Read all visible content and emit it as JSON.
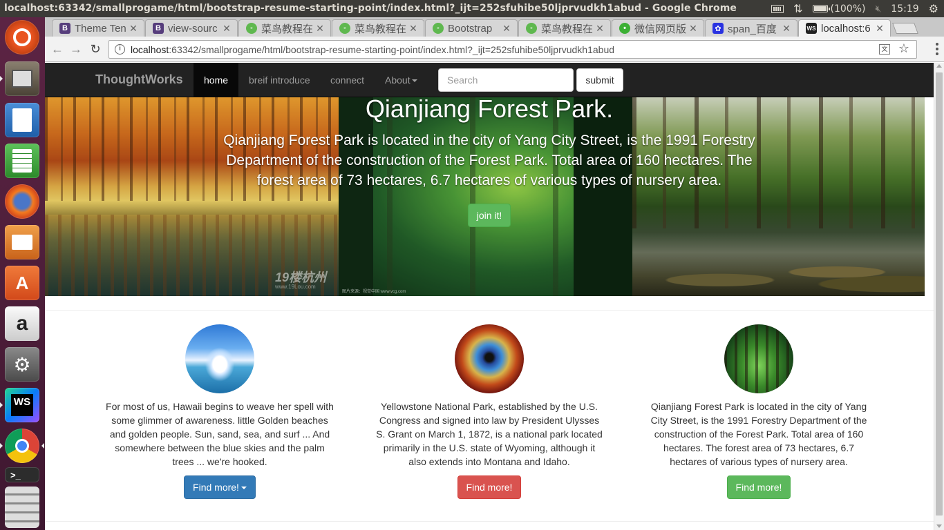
{
  "system": {
    "window_title": "localhost:63342/smallprogame/html/bootstrap-resume-starting-point/index.html?_ijt=252sfuhibe50ljprvudkh1abud - Google Chrome",
    "battery": "(100%)",
    "clock": "15:19"
  },
  "tabs": [
    {
      "label": "Theme Ten",
      "icon": "bootstrap-favicon",
      "color": "#563d7c"
    },
    {
      "label": "view-sourc",
      "icon": "bootstrap-favicon",
      "color": "#563d7c"
    },
    {
      "label": "菜鸟教程在",
      "icon": "runoob-favicon",
      "color": "#5fb84f"
    },
    {
      "label": "菜鸟教程在",
      "icon": "runoob-favicon",
      "color": "#5fb84f"
    },
    {
      "label": "Bootstrap",
      "icon": "runoob-favicon",
      "color": "#5fb84f"
    },
    {
      "label": "菜鸟教程在",
      "icon": "runoob-favicon",
      "color": "#5fb84f"
    },
    {
      "label": "微信网页版",
      "icon": "wechat-favicon",
      "color": "#3cb034"
    },
    {
      "label": "span_百度",
      "icon": "baidu-paw-favicon",
      "color": "#2932e1"
    },
    {
      "label": "localhost:6",
      "icon": "webstorm-favicon",
      "color": "#222222"
    }
  ],
  "omnibox": {
    "host": "localhost",
    "rest": ":63342/smallprogame/html/bootstrap-resume-starting-point/index.html?_ijt=252sfuhibe50ljprvudkh1abud"
  },
  "navbar": {
    "brand": "ThoughtWorks",
    "items": [
      "home",
      "breif introduce",
      "connect",
      "About"
    ],
    "search_placeholder": "Search",
    "submit_label": "submit"
  },
  "hero": {
    "title": "Qianjiang Forest Park.",
    "text": "Qianjiang Forest Park is located in the city of Yang City Street, is the 1991 Forestry Department of the construction of the Forest Park. Total area of 160 hectares. The forest area of 73 hectares, 6.7 hectares of various types of nursery area.",
    "button": "join it!",
    "watermark": "19楼杭州",
    "watermark_url": "www.19Lou.com",
    "photo_credit": "图片来源：视觉中国 www.vcg.com"
  },
  "features": [
    {
      "text": "For most of us, Hawaii begins to weave her spell with some glimmer of awareness. little Golden beaches and golden people. Sun, sand, sea, and surf ... And somewhere between the blue skies and the palm trees ... we're hooked.",
      "button": "Find more!",
      "button_color": "#337ab7"
    },
    {
      "text": "Yellowstone National Park, established by the U.S. Congress and signed into law by President Ulysses S. Grant on March 1, 1872, is a national park located primarily in the U.S. state of Wyoming, although it also extends into Montana and Idaho.",
      "button": "Find more!",
      "button_color": "#d9534f"
    },
    {
      "text": "Qianjiang Forest Park is located in the city of Yang City Street, is the 1991 Forestry Department of the construction of the Forest Park. Total area of 160 hectares. The forest area of 73 hectares, 6.7 hectares of various types of nursery area.",
      "button": "Find more!",
      "button_color": "#5cb85c"
    }
  ]
}
